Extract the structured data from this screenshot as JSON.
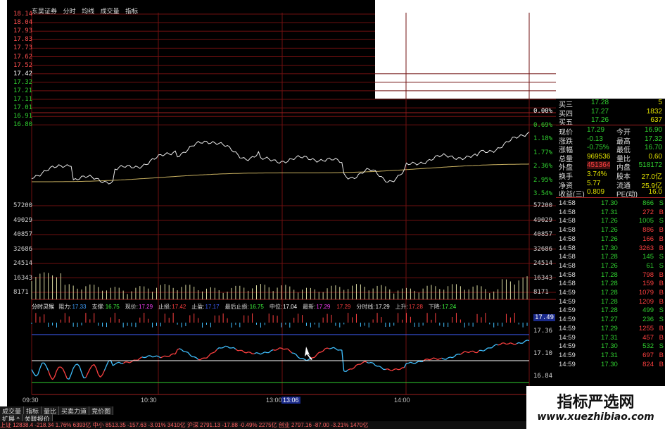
{
  "header": {
    "title": "东吴证券",
    "mode_tabs": [
      "分时",
      "均线",
      "成交量",
      "指标"
    ]
  },
  "price_axis_left": [
    "18.14",
    "18.04",
    "17.93",
    "17.83",
    "17.73",
    "17.62",
    "17.52",
    "17.42",
    "17.32",
    "17.21",
    "17.11",
    "17.01",
    "16.91",
    "16.80"
  ],
  "price_axis_right": [
    "0.00%",
    "0.69%",
    "1.18%",
    "1.77%",
    "2.36%",
    "2.95%",
    "3.54%"
  ],
  "volume_axis": [
    "57200",
    "49029",
    "40857",
    "32686",
    "24514",
    "16343",
    "8171"
  ],
  "indicator_axis": [
    "17.49",
    "17.36",
    "17.10",
    "16.84"
  ],
  "indicator_line": {
    "name": "分时灵猴",
    "items": [
      {
        "label": "阻力:",
        "value": "17.33",
        "color": "#40a0ff"
      },
      {
        "label": "支撑:",
        "value": "16.75",
        "color": "#40ff40"
      },
      {
        "label": "现价:",
        "value": "17.29",
        "color": "#ff40ff"
      },
      {
        "label": "止损:",
        "value": "17.42",
        "color": "#ff4040"
      },
      {
        "label": "止盈:",
        "value": "17.17",
        "color": "#4060ff"
      },
      {
        "label": "最后止损:",
        "value": "16.75",
        "color": "#40ff40"
      },
      {
        "label": "中位:",
        "value": "17.04",
        "color": "#ffffff"
      },
      {
        "label": "最新:",
        "value": "17.29",
        "color": "#ff40ff"
      },
      {
        "label": "",
        "value": "17.29",
        "color": "#ff4040"
      },
      {
        "label": "分时线:",
        "value": "17.29",
        "color": "#ffffff"
      },
      {
        "label": "上升:",
        "value": "17.28",
        "color": "#ff4040"
      },
      {
        "label": "下降:",
        "value": "17.24",
        "color": "#40ff40"
      }
    ]
  },
  "time_axis": [
    "09:30",
    "10:30",
    "13:00",
    "13:06",
    "14:00"
  ],
  "quote": {
    "top_rows": [
      {
        "label": "买三",
        "price": "17.28",
        "vol": "5"
      },
      {
        "label": "买四",
        "price": "17.27",
        "vol": "1832"
      },
      {
        "label": "买五",
        "price": "17.26",
        "vol": "637"
      }
    ],
    "stats": [
      {
        "l1": "现价",
        "v1": "17.29",
        "l2": "今开",
        "v2": "16.90"
      },
      {
        "l1": "涨跌",
        "v1": "-0.13",
        "l2": "最高",
        "v2": "17.32"
      },
      {
        "l1": "涨幅",
        "v1": "-0.75%",
        "l2": "最低",
        "v2": "16.70"
      },
      {
        "l1": "总量",
        "v1": "969536",
        "l2": "量比",
        "v2": "0.60"
      },
      {
        "l1": "外盘",
        "v1": "451364",
        "l2": "内盘",
        "v2": "518172"
      },
      {
        "l1": "换手",
        "v1": "3.74%",
        "l2": "股本",
        "v2": "27.0亿"
      },
      {
        "l1": "净资",
        "v1": "5.77",
        "l2": "流通",
        "v2": "25.9亿"
      },
      {
        "l1": "收益(三)",
        "v1": "0.809",
        "l2": "PE(动)",
        "v2": "16.0"
      }
    ]
  },
  "ticks": [
    {
      "time": "14:58",
      "price": "17.30",
      "vol": "866",
      "dir": "S"
    },
    {
      "time": "14:58",
      "price": "17.31",
      "vol": "272",
      "dir": "B"
    },
    {
      "time": "14:58",
      "price": "17.26",
      "vol": "1005",
      "dir": "S"
    },
    {
      "time": "14:58",
      "price": "17.26",
      "vol": "886",
      "dir": "B"
    },
    {
      "time": "14:58",
      "price": "17.26",
      "vol": "166",
      "dir": "B"
    },
    {
      "time": "14:58",
      "price": "17.30",
      "vol": "3263",
      "dir": "B"
    },
    {
      "time": "14:58",
      "price": "17.28",
      "vol": "145",
      "dir": "S"
    },
    {
      "time": "14:58",
      "price": "17.26",
      "vol": "61",
      "dir": "S"
    },
    {
      "time": "14:58",
      "price": "17.28",
      "vol": "798",
      "dir": "B"
    },
    {
      "time": "14:58",
      "price": "17.28",
      "vol": "159",
      "dir": "B"
    },
    {
      "time": "14:59",
      "price": "17.28",
      "vol": "1079",
      "dir": "B"
    },
    {
      "time": "14:59",
      "price": "17.28",
      "vol": "1209",
      "dir": "B"
    },
    {
      "time": "14:59",
      "price": "17.28",
      "vol": "499",
      "dir": "S"
    },
    {
      "time": "14:59",
      "price": "17.27",
      "vol": "236",
      "dir": "S"
    },
    {
      "time": "14:59",
      "price": "17.29",
      "vol": "1255",
      "dir": "B"
    },
    {
      "time": "14:59",
      "price": "17.31",
      "vol": "457",
      "dir": "B"
    },
    {
      "time": "14:59",
      "price": "17.30",
      "vol": "532",
      "dir": "S"
    },
    {
      "time": "14:59",
      "price": "17.31",
      "vol": "697",
      "dir": "B"
    },
    {
      "time": "14:59",
      "price": "17.30",
      "vol": "824",
      "dir": "B"
    }
  ],
  "bottom_tabs": [
    "成交量",
    "指标",
    "量比",
    "买卖力道",
    "竞价图"
  ],
  "bottom_tabs2": [
    "扩展 ^",
    "关联报价"
  ],
  "status_text": "上证 12838.4  -218.34  1.76%    6393亿    中小 8513.35  -157.63  -3.01%    3410亿    沪深 2791.13  -17.88  -0.49%    2275亿    创业 2797.16  -87.00  -3.21%    1470亿",
  "watermark": {
    "cn": "指标严选网",
    "url": "www.xuezhibiao.com"
  },
  "colors": {
    "up": "#ff4040",
    "down": "#30d030",
    "neutral": "#ffffff",
    "grid": "#801010",
    "avg_line": "#c8b060"
  }
}
